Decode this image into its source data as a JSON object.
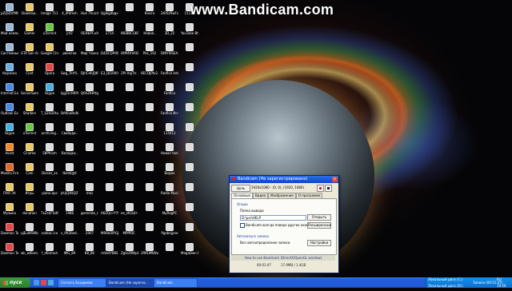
{
  "watermark": "www.Bandicam.com",
  "desktop_icons": [
    {
      "label": "pZQiDnfMhm",
      "c": "#9bb8d6"
    },
    {
      "label": "Downloa..",
      "c": "#e8c96a"
    },
    {
      "label": "Image 711",
      "c": "#ddd"
    },
    {
      "label": "4_4fdmsh",
      "c": "#ddd"
    },
    {
      "label": "Hue Thunder",
      "c": "#ddd"
    },
    {
      "label": "Qglkgdbgvq",
      "c": "#ddd"
    },
    {
      "label": "",
      "c": "#ddd"
    },
    {
      "label": "Книга",
      "c": "#ddd"
    },
    {
      "label": "2Ю5zRwFsTC",
      "c": "#ddd"
    },
    {
      "label": "11111",
      "c": "#ddd"
    },
    {
      "label": "Мой компьютер",
      "c": "#9bb8d6"
    },
    {
      "label": "Gamer",
      "c": "#e8c96a"
    },
    {
      "label": "uTorrent",
      "c": "#6cc64a"
    },
    {
      "label": "jnf2",
      "c": "#ddd"
    },
    {
      "label": "ОЕНЬРСнАВМ",
      "c": "#ddd"
    },
    {
      "label": "2714",
      "c": "#ddd"
    },
    {
      "label": "WEBBCGKR4",
      "c": "#ddd"
    },
    {
      "label": "Новая..",
      "c": "#ddd"
    },
    {
      "label": "3D_22",
      "c": "#ddd"
    },
    {
      "label": "YouTube Bt..",
      "c": "#ddd"
    },
    {
      "label": "Системные..",
      "c": "#9bb8d6"
    },
    {
      "label": "GTA San Andreas",
      "c": "#e8c96a"
    },
    {
      "label": "Google Chrome",
      "c": "#e8c96a"
    },
    {
      "label": "рвемгов",
      "c": "#ddd"
    },
    {
      "label": "Мир танков",
      "c": "#ddd"
    },
    {
      "label": "D4DCQR90",
      "c": "#ddd"
    },
    {
      "label": "iMPI4tmRDM",
      "c": "#ddd"
    },
    {
      "label": "Pbs_142",
      "c": "#ddd"
    },
    {
      "label": "DINYSISEA..",
      "c": "#ddd"
    },
    {
      "label": "",
      "c": "#ddd"
    },
    {
      "label": "Корзина",
      "c": "#6fb0e0"
    },
    {
      "label": "Cont",
      "c": "#e8c96a"
    },
    {
      "label": "Opera",
      "c": "#e04a4a"
    },
    {
      "label": "Swg_Terfil..",
      "c": "#ddd"
    },
    {
      "label": "DJhCehJQKW",
      "c": "#ddd"
    },
    {
      "label": "Б3_Ш1000..",
      "c": "#ddd"
    },
    {
      "label": "2Pl-mgTtr..",
      "c": "#ddd"
    },
    {
      "label": "0ECOJ0fx2..",
      "c": "#ddd"
    },
    {
      "label": "Fanfica Interstellar",
      "c": "#ddd"
    },
    {
      "label": "",
      "c": "#ddd"
    },
    {
      "label": "Internet Explorer",
      "c": "#4a8ae0"
    },
    {
      "label": "ServerSamp",
      "c": "#e8c96a"
    },
    {
      "label": "Skype",
      "c": "#4ab0e0"
    },
    {
      "label": "kjgZLrHRPHd",
      "c": "#ddd"
    },
    {
      "label": "Q6hZlHRtqo",
      "c": "#ddd"
    },
    {
      "label": "",
      "c": "#ddd"
    },
    {
      "label": "",
      "c": "#ddd"
    },
    {
      "label": "",
      "c": "#ddd"
    },
    {
      "label": "Fanfica",
      "c": "#ddd"
    },
    {
      "label": "",
      "c": "#ddd"
    },
    {
      "label": "Outlook Express",
      "c": "#4a8ae0"
    },
    {
      "label": "Shaders",
      "c": "#e8c96a"
    },
    {
      "label": "T_S2SGRtun",
      "c": "#ddd"
    },
    {
      "label": "ВАКnaHoN",
      "c": "#ddd"
    },
    {
      "label": "",
      "c": "#ddd"
    },
    {
      "label": "",
      "c": "#ddd"
    },
    {
      "label": "",
      "c": "#ddd"
    },
    {
      "label": "",
      "c": "#ddd"
    },
    {
      "label": "Fanfica Интерстелл..",
      "c": "#ddd"
    },
    {
      "label": "",
      "c": "#ddd"
    },
    {
      "label": "Skype",
      "c": "#4ab0e0"
    },
    {
      "label": "uTorrent",
      "c": "#6cc64a"
    },
    {
      "label": "archiving..",
      "c": "#ddd"
    },
    {
      "label": "Свобода..",
      "c": "#ddd"
    },
    {
      "label": "",
      "c": "#ddd"
    },
    {
      "label": "",
      "c": "#ddd"
    },
    {
      "label": "",
      "c": "#ddd"
    },
    {
      "label": "",
      "c": "#ddd"
    },
    {
      "label": "115412",
      "c": "#ddd"
    },
    {
      "label": "",
      "c": "#ddd"
    },
    {
      "label": "Avast",
      "c": "#f08a2a"
    },
    {
      "label": "Cinema",
      "c": "#e8c96a"
    },
    {
      "label": "S8Pfcom",
      "c": "#ddd"
    },
    {
      "label": "Вкладка..",
      "c": "#ddd"
    },
    {
      "label": "",
      "c": "#ddd"
    },
    {
      "label": "",
      "c": "#ddd"
    },
    {
      "label": "",
      "c": "#ddd"
    },
    {
      "label": "",
      "c": "#ddd"
    },
    {
      "label": "Новая папка",
      "c": "#ddd"
    },
    {
      "label": "",
      "c": "#ddd"
    },
    {
      "label": "Mozilla Firefox",
      "c": "#e06a2a"
    },
    {
      "label": "Cam",
      "c": "#e8c96a"
    },
    {
      "label": "Dieses_xx",
      "c": "#ddd"
    },
    {
      "label": "lbmklgld",
      "c": "#ddd"
    },
    {
      "label": "",
      "c": "#ddd"
    },
    {
      "label": "",
      "c": "#ddd"
    },
    {
      "label": "",
      "c": "#ddd"
    },
    {
      "label": "",
      "c": "#ddd"
    },
    {
      "label": "Видео",
      "c": "#ddd"
    },
    {
      "label": "",
      "c": "#ddd"
    },
    {
      "label": "ПАО ЗА",
      "c": "#e8c96a"
    },
    {
      "label": "Игры",
      "c": "#e8c96a"
    },
    {
      "label": "piano.eps",
      "c": "#ddd"
    },
    {
      "label": "JsUjQHkQ2Y",
      "c": "#ddd"
    },
    {
      "label": "mes",
      "c": "#ddd"
    },
    {
      "label": "",
      "c": "#ddd"
    },
    {
      "label": "",
      "c": "#ddd"
    },
    {
      "label": "",
      "c": "#ddd"
    },
    {
      "label": "Radio MusicRad..",
      "c": "#ddd"
    },
    {
      "label": "",
      "c": "#ddd"
    },
    {
      "label": "Музыка",
      "c": "#e8c96a"
    },
    {
      "label": "donation",
      "c": "#e8c96a"
    },
    {
      "label": "TxZskFTuKS0",
      "c": "#ddd"
    },
    {
      "label": "1986",
      "c": "#ddd"
    },
    {
      "label": "generate_n..",
      "c": "#ddd"
    },
    {
      "label": "A6ZQcr-P70",
      "c": "#ddd"
    },
    {
      "label": "ee_zK1Шт..",
      "c": "#ddd"
    },
    {
      "label": "",
      "c": "#ddd"
    },
    {
      "label": "MyRogPC",
      "c": "#ddd"
    },
    {
      "label": "",
      "c": "#ddd"
    },
    {
      "label": "Daemon Tools",
      "c": "#e04a4a"
    },
    {
      "label": "uJEuWSWbS",
      "c": "#ddd"
    },
    {
      "label": "noblac.ico",
      "c": "#ddd"
    },
    {
      "label": "v_lfit2bed..",
      "c": "#ddd"
    },
    {
      "label": "2007",
      "c": "#ddd"
    },
    {
      "label": "MR6kOIPGJ",
      "c": "#ddd"
    },
    {
      "label": "MPfPDF..",
      "c": "#ddd"
    },
    {
      "label": "",
      "c": "#ddd"
    },
    {
      "label": "Pgobojpne",
      "c": "#ddd"
    },
    {
      "label": "",
      "c": "#ddd"
    },
    {
      "label": "Daemon Tools Lite",
      "c": "#e04a4a"
    },
    {
      "label": "wk_wl6nm..",
      "c": "#ddd"
    },
    {
      "label": "f_d6nmuh",
      "c": "#ddd"
    },
    {
      "label": "IMG_89",
      "c": "#ddd"
    },
    {
      "label": "88_86",
      "c": "#ddd"
    },
    {
      "label": "mVe4Y8RE",
      "c": "#ddd"
    },
    {
      "label": "Zgtz2RWpb",
      "c": "#ddd"
    },
    {
      "label": "2fM1MKWu..",
      "c": "#ddd"
    },
    {
      "label": "",
      "c": "#ddd"
    },
    {
      "label": "MegaDwn Pro",
      "c": "#ddd"
    }
  ],
  "bandicam": {
    "title": "Bandicam (Не зарегистрировано)",
    "close": "x",
    "target_button": "Цель",
    "resolution": "1920x1080 - (0, 0), (1920, 1080)",
    "tabs": [
      "Основные",
      "Видео",
      "Изображение",
      "О программе"
    ],
    "section_output": "Опции",
    "output_folder_label": "Папка вывода",
    "output_path": "D:\\pss\\HELP",
    "open_button": "Открыть",
    "always_on_top": "Bandicam всегда поверх других окон",
    "advanced_button": "Расширенные",
    "autostart_section": "Автозапуск записи",
    "autostart_text": "Вкл автоопределение записи",
    "settings_button": "Настройки",
    "help_link": "How to use Bandicam (DirectX/OpenGL window)",
    "status_time": "00:01:47",
    "status_size": "17.9MB / 1.4GB"
  },
  "taskbar": {
    "start": "пуск",
    "tasks": [
      "Скачать Бандикам",
      "Bandicam (Не зарегис..",
      "Bandicam"
    ],
    "tray_items": [
      "Локальный диск (C:)",
      "Локальный диск (D:)"
    ],
    "clock": "19:56",
    "language": "RU",
    "tray_status": "Записи (00:01:47)"
  }
}
